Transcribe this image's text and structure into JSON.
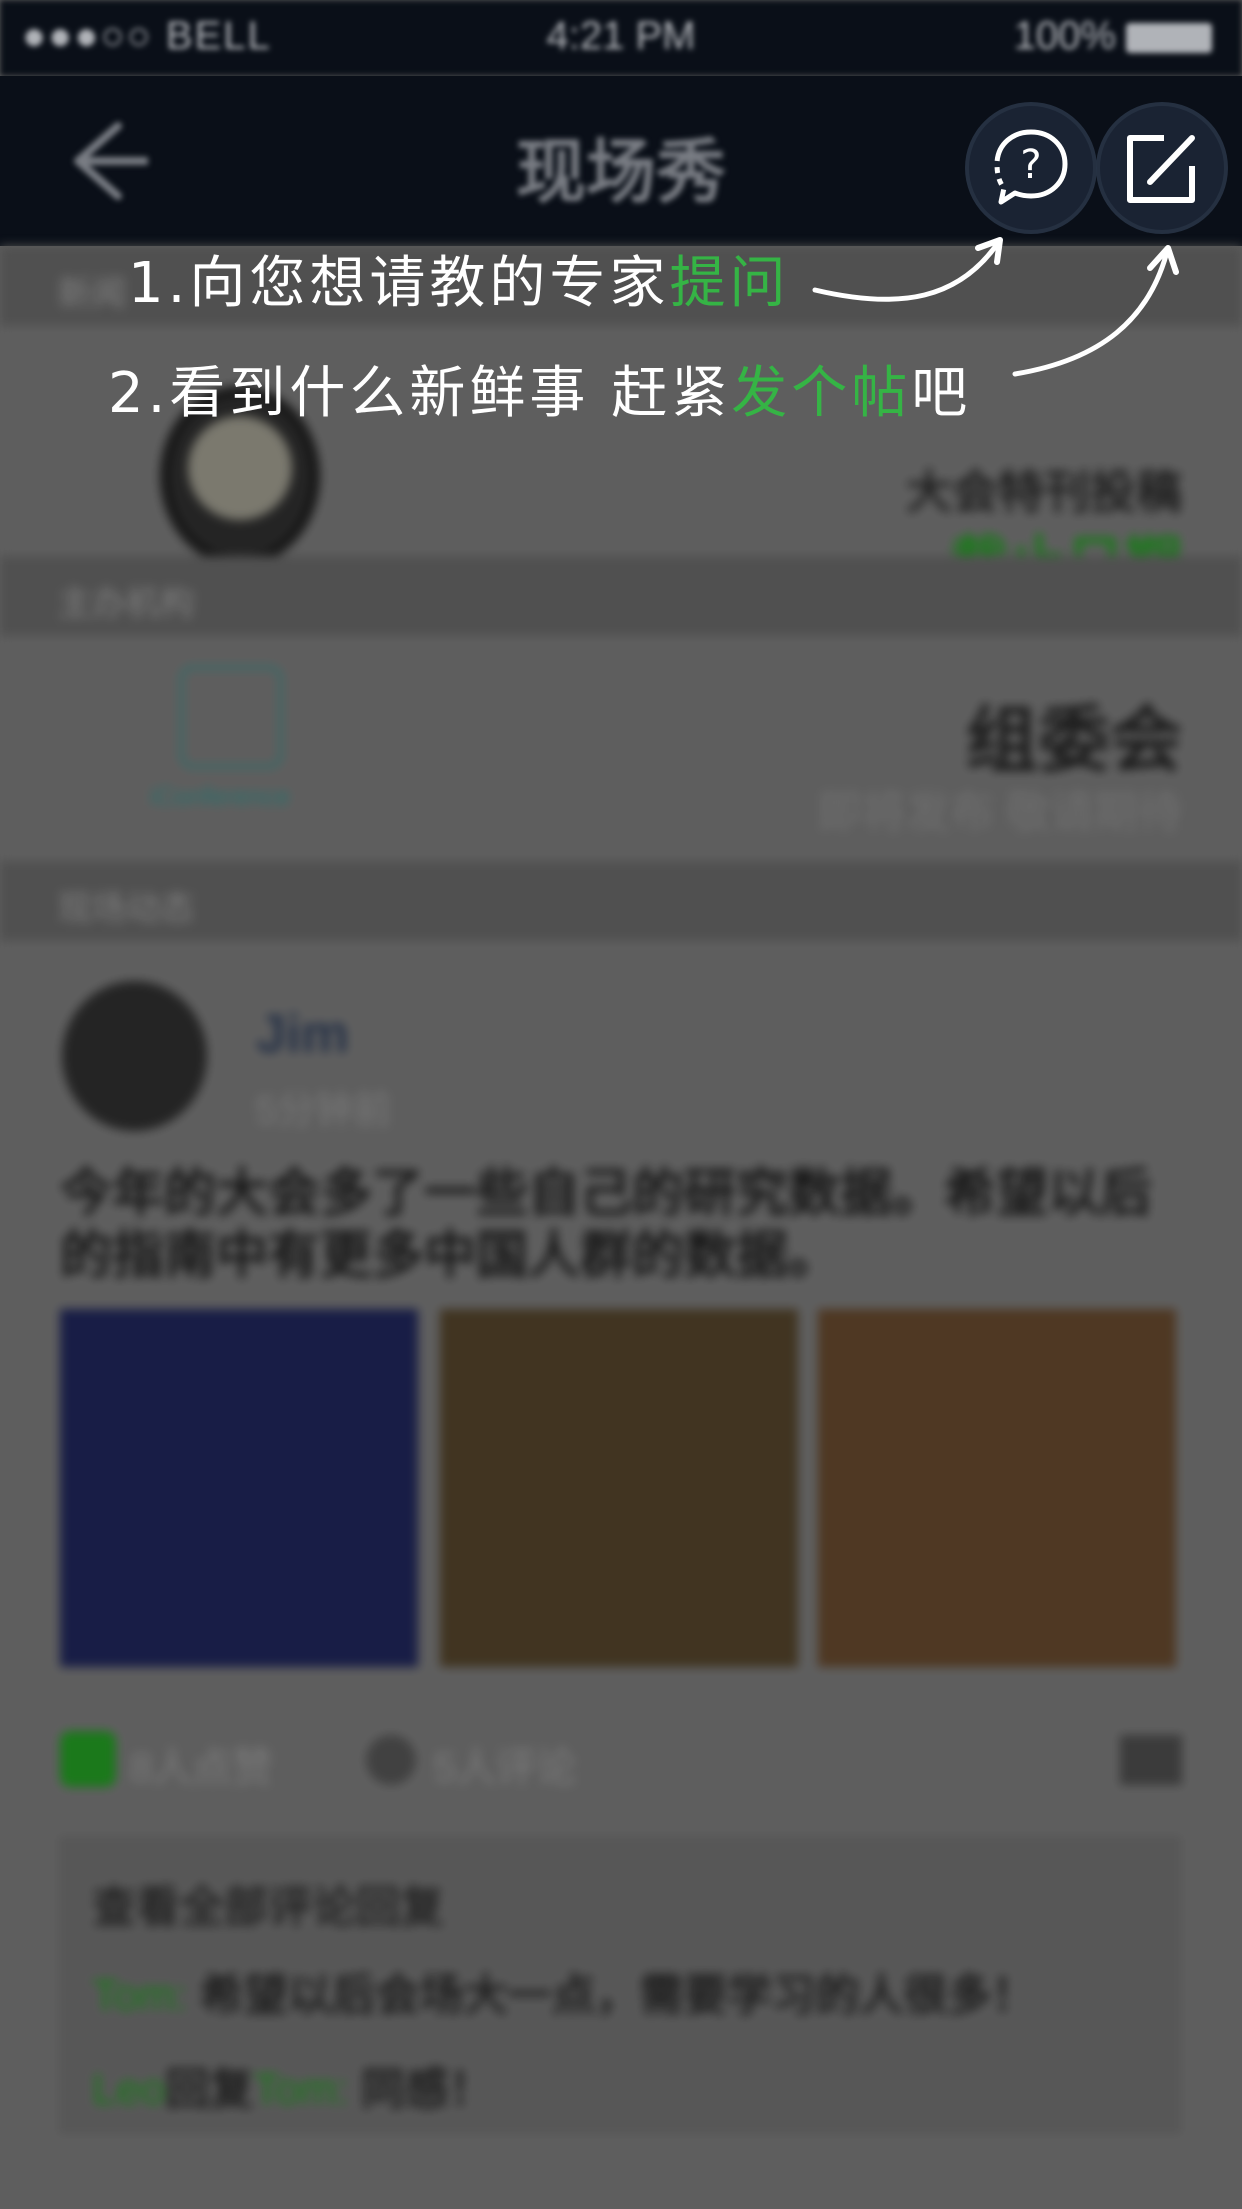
{
  "status_bar": {
    "signal": "●●●○○ BELL",
    "time": "4:21 PM",
    "battery": "100%"
  },
  "nav": {
    "title": "现场秀"
  },
  "sections": {
    "news": "新闻",
    "org": "主办机构",
    "live": "现场动态"
  },
  "banner": {
    "line1": "大会特刊投稿",
    "line2": "截止日期"
  },
  "organizer": {
    "logo_text": "iConference",
    "name": "组委会",
    "subtitle": "即将发布 敬请期待"
  },
  "post": {
    "user": "Jim",
    "time": "5分钟前",
    "text": "今年的大会多了一些自己的研究数据。希望以后的指南中有更多中国人群的数据。",
    "likes": "8人点赞",
    "comments_count": "5人评论",
    "comments_title": "查看全部评论回复",
    "comment1_user": "Tom:",
    "comment1_text": "希望以后会场大一点，需要学习的人很多！",
    "comment2_user1": "Leo",
    "comment2_reply": "回复",
    "comment2_user2": "Tom:",
    "comment2_text": "同感！"
  },
  "guide": {
    "hint1_prefix": "1.向您想请教的专家",
    "hint1_highlight": "提问",
    "hint2_prefix": "2.看到什么新鲜事 赶紧",
    "hint2_highlight": "发个帖",
    "hint2_suffix": "吧",
    "accent_color": "#35b445"
  },
  "icons": {
    "help": "question-bubble-icon",
    "post": "compose-icon",
    "back": "back-arrow-icon"
  }
}
